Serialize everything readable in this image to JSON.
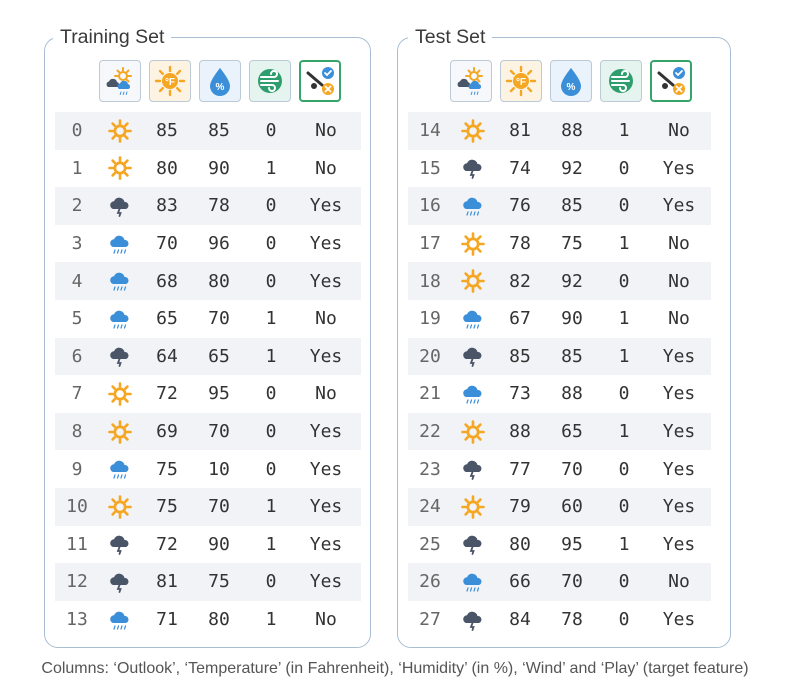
{
  "colors": {
    "border": "#a9bdd3",
    "sun": "#f5a623",
    "storm_cloud": "#4a5568",
    "rain_cloud": "#3b8fd9",
    "drop": "#3b8fd9",
    "wind": "#2f9e6e",
    "check": "#3b8fd9",
    "cross": "#f5a623",
    "row_shade": "#f1f3f7"
  },
  "header_icons": [
    "outlook-icon",
    "temperature-icon",
    "humidity-icon",
    "wind-icon",
    "play-icon"
  ],
  "training": {
    "title": "Training Set",
    "rows": [
      {
        "index": "0",
        "outlook": "sunny",
        "temperature": "85",
        "humidity": "85",
        "wind": "0",
        "play": "No"
      },
      {
        "index": "1",
        "outlook": "sunny",
        "temperature": "80",
        "humidity": "90",
        "wind": "1",
        "play": "No"
      },
      {
        "index": "2",
        "outlook": "overcast",
        "temperature": "83",
        "humidity": "78",
        "wind": "0",
        "play": "Yes"
      },
      {
        "index": "3",
        "outlook": "rainy",
        "temperature": "70",
        "humidity": "96",
        "wind": "0",
        "play": "Yes"
      },
      {
        "index": "4",
        "outlook": "rainy",
        "temperature": "68",
        "humidity": "80",
        "wind": "0",
        "play": "Yes"
      },
      {
        "index": "5",
        "outlook": "rainy",
        "temperature": "65",
        "humidity": "70",
        "wind": "1",
        "play": "No"
      },
      {
        "index": "6",
        "outlook": "overcast",
        "temperature": "64",
        "humidity": "65",
        "wind": "1",
        "play": "Yes"
      },
      {
        "index": "7",
        "outlook": "sunny",
        "temperature": "72",
        "humidity": "95",
        "wind": "0",
        "play": "No"
      },
      {
        "index": "8",
        "outlook": "sunny",
        "temperature": "69",
        "humidity": "70",
        "wind": "0",
        "play": "Yes"
      },
      {
        "index": "9",
        "outlook": "rainy",
        "temperature": "75",
        "humidity": "10",
        "wind": "0",
        "play": "Yes"
      },
      {
        "index": "10",
        "outlook": "sunny",
        "temperature": "75",
        "humidity": "70",
        "wind": "1",
        "play": "Yes"
      },
      {
        "index": "11",
        "outlook": "overcast",
        "temperature": "72",
        "humidity": "90",
        "wind": "1",
        "play": "Yes"
      },
      {
        "index": "12",
        "outlook": "overcast",
        "temperature": "81",
        "humidity": "75",
        "wind": "0",
        "play": "Yes"
      },
      {
        "index": "13",
        "outlook": "rainy",
        "temperature": "71",
        "humidity": "80",
        "wind": "1",
        "play": "No"
      }
    ]
  },
  "test": {
    "title": "Test Set",
    "rows": [
      {
        "index": "14",
        "outlook": "sunny",
        "temperature": "81",
        "humidity": "88",
        "wind": "1",
        "play": "No"
      },
      {
        "index": "15",
        "outlook": "overcast",
        "temperature": "74",
        "humidity": "92",
        "wind": "0",
        "play": "Yes"
      },
      {
        "index": "16",
        "outlook": "rainy",
        "temperature": "76",
        "humidity": "85",
        "wind": "0",
        "play": "Yes"
      },
      {
        "index": "17",
        "outlook": "sunny",
        "temperature": "78",
        "humidity": "75",
        "wind": "1",
        "play": "No"
      },
      {
        "index": "18",
        "outlook": "sunny",
        "temperature": "82",
        "humidity": "92",
        "wind": "0",
        "play": "No"
      },
      {
        "index": "19",
        "outlook": "rainy",
        "temperature": "67",
        "humidity": "90",
        "wind": "1",
        "play": "No"
      },
      {
        "index": "20",
        "outlook": "overcast",
        "temperature": "85",
        "humidity": "85",
        "wind": "1",
        "play": "Yes"
      },
      {
        "index": "21",
        "outlook": "rainy",
        "temperature": "73",
        "humidity": "88",
        "wind": "0",
        "play": "Yes"
      },
      {
        "index": "22",
        "outlook": "sunny",
        "temperature": "88",
        "humidity": "65",
        "wind": "1",
        "play": "Yes"
      },
      {
        "index": "23",
        "outlook": "overcast",
        "temperature": "77",
        "humidity": "70",
        "wind": "0",
        "play": "Yes"
      },
      {
        "index": "24",
        "outlook": "sunny",
        "temperature": "79",
        "humidity": "60",
        "wind": "0",
        "play": "Yes"
      },
      {
        "index": "25",
        "outlook": "overcast",
        "temperature": "80",
        "humidity": "95",
        "wind": "1",
        "play": "Yes"
      },
      {
        "index": "26",
        "outlook": "rainy",
        "temperature": "66",
        "humidity": "70",
        "wind": "0",
        "play": "No"
      },
      {
        "index": "27",
        "outlook": "overcast",
        "temperature": "84",
        "humidity": "78",
        "wind": "0",
        "play": "Yes"
      }
    ]
  },
  "caption": "Columns: ‘Outlook’, ‘Temperature’ (in Fahrenheit), ‘Humidity’ (in %), ‘Wind’ and ‘Play’ (target feature)"
}
